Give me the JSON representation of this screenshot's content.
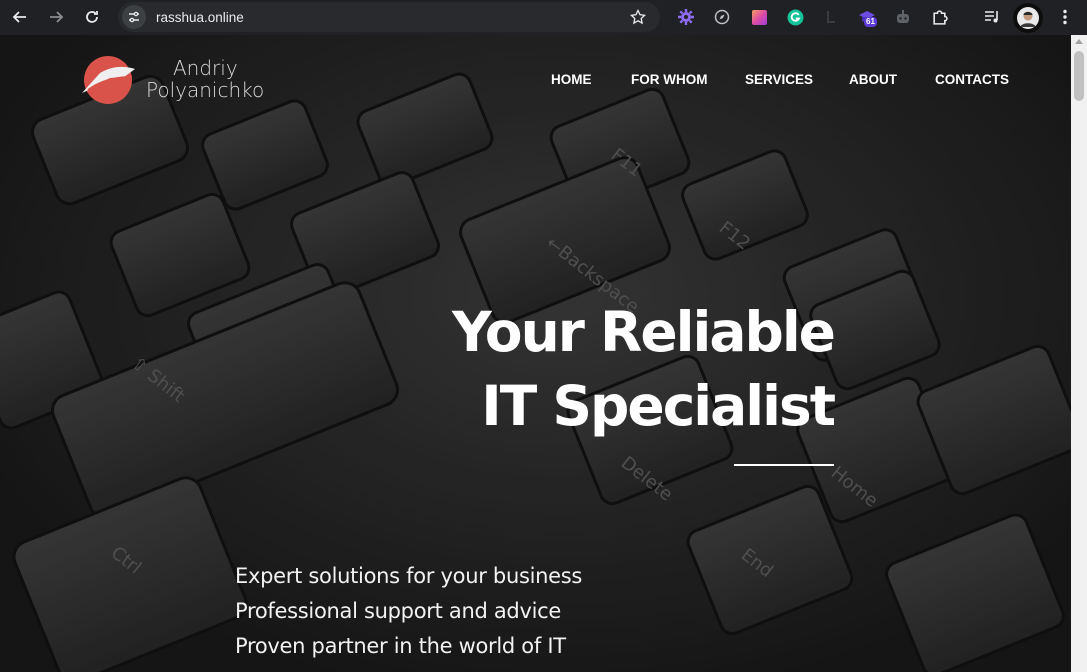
{
  "browser": {
    "url": "rasshua.online",
    "extension_badge": "61",
    "icons": [
      "back-icon",
      "forward-icon",
      "reload-icon",
      "site-info-icon",
      "bookmark-star-icon",
      "gear-extension-icon",
      "compass-extension-icon",
      "gradient-extension-icon",
      "grammarly-extension-icon",
      "dark-extension-icon",
      "shield-extension-icon",
      "robot-extension-icon",
      "puzzle-extensions-icon",
      "media-control-icon",
      "profile-avatar",
      "kebab-menu-icon"
    ]
  },
  "site": {
    "logo": {
      "line1": "Andriy",
      "line2": "Polyanichko",
      "mark_color": "#d9534a"
    },
    "nav": [
      {
        "label": "HOME"
      },
      {
        "label": "FOR WHOM"
      },
      {
        "label": "SERVICES"
      },
      {
        "label": "ABOUT"
      },
      {
        "label": "CONTACTS"
      }
    ],
    "hero": {
      "title_line1": "Your Reliable",
      "title_line2": "IT Specialist",
      "taglines": [
        "Expert solutions for your business",
        "Professional support and advice",
        "Proven partner in the world of IT"
      ]
    }
  },
  "colors": {
    "toolbar": "#202124",
    "omnibox": "#282a2d",
    "hero_text": "#ffffff",
    "accent": "#d9534a"
  }
}
